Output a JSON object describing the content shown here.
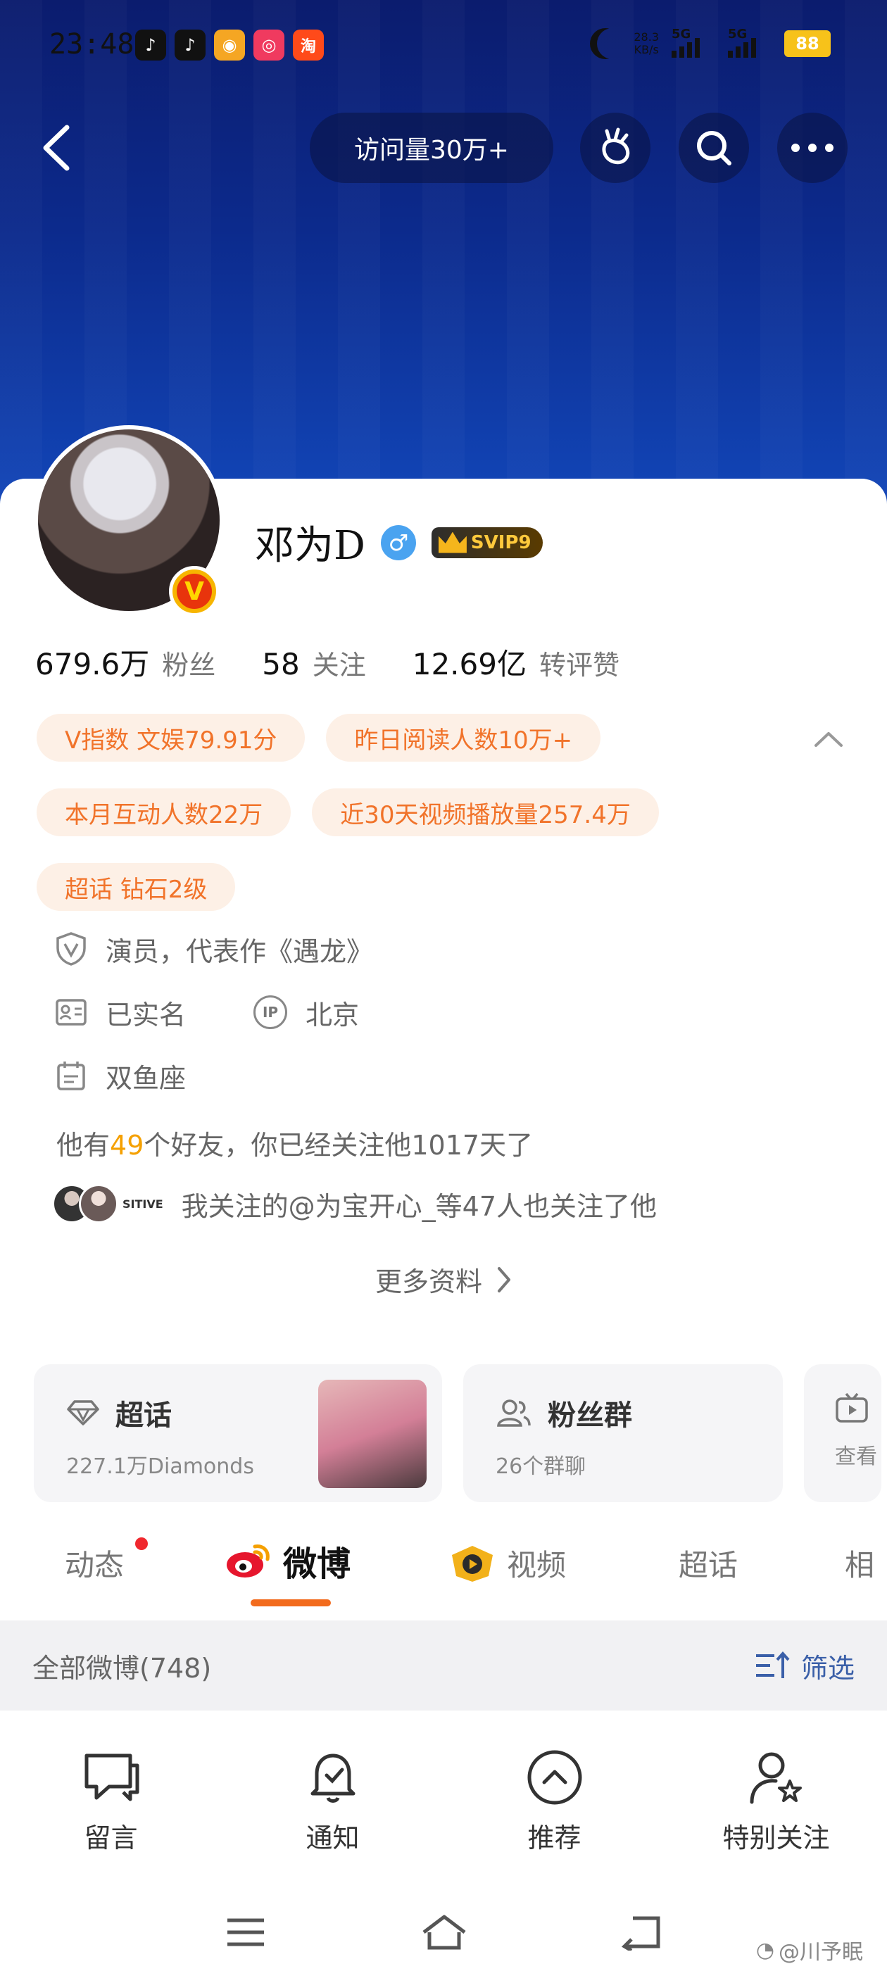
{
  "status_bar": {
    "time": "23:48",
    "net_speed": "28.3\nKB/s",
    "net_speed_value": "28.3",
    "net_speed_unit": "KB/s",
    "signal1": "5G",
    "signal2": "5G",
    "battery": "88",
    "apps": [
      {
        "icon": "douyin-icon",
        "color": "#111111",
        "glyph": "♪"
      },
      {
        "icon": "douyin-icon",
        "color": "#111111",
        "glyph": "♪"
      },
      {
        "icon": "weibo-icon",
        "color": "#f5a623",
        "glyph": "◉"
      },
      {
        "icon": "meituan-icon",
        "color": "#f03a5f",
        "glyph": "◎"
      },
      {
        "icon": "taobao-icon",
        "color": "#ff4a1a",
        "glyph": "淘"
      }
    ]
  },
  "topnav": {
    "visits": "访问量30万+"
  },
  "profile": {
    "name": "邓为D",
    "gender_symbol": "♂",
    "svip": "SVIP9",
    "verified_badge": "V",
    "stats": [
      {
        "num": "679.6万",
        "label": "粉丝"
      },
      {
        "num": "58",
        "label": "关注"
      },
      {
        "num": "12.69亿",
        "label": "转评赞"
      }
    ],
    "tags_row1": [
      "V指数 文娱79.91分",
      "昨日阅读人数10万+"
    ],
    "tags_row2": [
      "本月互动人数22万",
      "近30天视频播放量257.4万"
    ],
    "tags_row3": [
      "超话 钻石2级"
    ],
    "info": {
      "occupation": "演员，代表作《遇龙》",
      "realname": "已实名",
      "ip_label": "IP",
      "location": "北京",
      "zodiac": "双鱼座"
    },
    "friends_prefix": "他有",
    "friends_count": "49",
    "friends_suffix": "个好友，你已经关注他1017天了",
    "mutual_text": "我关注的@为宝开心_等47人也关注了他",
    "mutual_tag": "SITIVE",
    "more_label": "更多资料"
  },
  "features": {
    "supertopic": {
      "title": "超话",
      "sub": "227.1万Diamonds"
    },
    "fangroup": {
      "title": "粉丝群",
      "sub": "26个群聊"
    },
    "third": {
      "sub": "查看"
    }
  },
  "tabs": [
    {
      "label": "动态",
      "badge": true
    },
    {
      "label": "微博",
      "active": true
    },
    {
      "label": "视频"
    },
    {
      "label": "超话"
    },
    {
      "label": "相"
    }
  ],
  "filterbar": {
    "count": "全部微博(748)",
    "filter": "筛选"
  },
  "actions": [
    {
      "label": "留言",
      "icon": "message-icon"
    },
    {
      "label": "通知",
      "icon": "bell-icon"
    },
    {
      "label": "推荐",
      "icon": "recommend-icon"
    },
    {
      "label": "特别关注",
      "icon": "special-follow-icon"
    }
  ],
  "watermark": "@川予眠",
  "colors": {
    "accent_orange": "#f26b1d",
    "tag_text": "#f1732a",
    "banner_blue": "#0c2a8c",
    "link_blue": "#3a5fa8"
  }
}
